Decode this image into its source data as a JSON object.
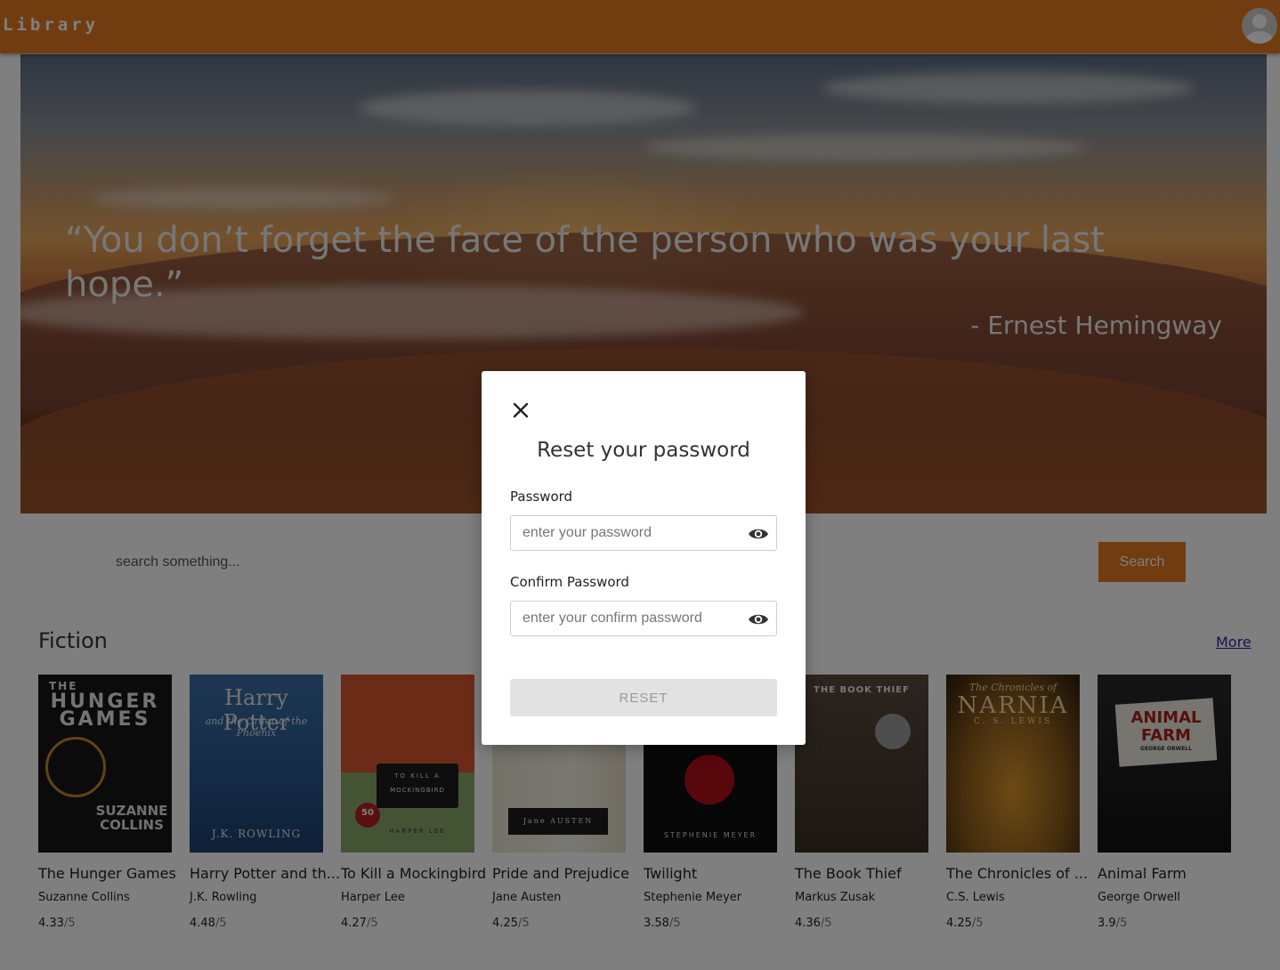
{
  "navbar": {
    "brand": "Library",
    "avatar_icon": "user-avatar-icon"
  },
  "hero": {
    "quote": "“You don’t forget the face of the person who was your last hope.”",
    "author": "- Ernest Hemingway"
  },
  "search": {
    "placeholder": "search something...",
    "button_label": "Search"
  },
  "section": {
    "title": "Fiction",
    "more_label": "More",
    "books": [
      {
        "title": "The Hunger Games",
        "author": "Suzanne Collins",
        "rating": "4.33",
        "max": "/5",
        "cover": {
          "line1": "THE",
          "line2": "HUNGER",
          "line3": "GAMES",
          "line4": "SUZANNE",
          "line5": "COLLINS"
        }
      },
      {
        "title": "Harry Potter and th...",
        "author": "J.K. Rowling",
        "rating": "4.48",
        "max": "/5",
        "cover": {
          "line1": "Harry Potter",
          "line2": "and the Order of the Phoenix",
          "line3": "J.K. ROWLING"
        }
      },
      {
        "title": "To Kill a Mockingbird",
        "author": "Harper Lee",
        "rating": "4.27",
        "max": "/5",
        "cover": {
          "line1": "TO KILL A",
          "line2": "MOCKINGBIRD",
          "line3": "HARPER LEE",
          "line4": "50"
        }
      },
      {
        "title": "Pride and Prejudice",
        "author": "Jane Austen",
        "rating": "4.25",
        "max": "/5",
        "cover": {
          "line1": "Jane AUSTEN"
        }
      },
      {
        "title": "Twilight",
        "author": "Stephenie Meyer",
        "rating": "3.58",
        "max": "/5",
        "cover": {
          "line1": "STEPHENIE MEYER"
        }
      },
      {
        "title": "The Book Thief",
        "author": "Markus Zusak",
        "rating": "4.36",
        "max": "/5",
        "cover": {
          "line1": "THE BOOK THIEF"
        }
      },
      {
        "title": "The Chronicles of ...",
        "author": "C.S. Lewis",
        "rating": "4.25",
        "max": "/5",
        "cover": {
          "line1": "The Chronicles of",
          "line2": "NARNIA",
          "line3": "C. S. LEWIS"
        }
      },
      {
        "title": "Animal Farm",
        "author": "George Orwell",
        "rating": "3.9",
        "max": "/5",
        "cover": {
          "line1": "ANIMAL",
          "line2": "FARM",
          "line3": "GEORGE ORWELL"
        }
      }
    ]
  },
  "modal": {
    "title": "Reset your password",
    "password_label": "Password",
    "password_placeholder": "enter your password",
    "confirm_label": "Confirm Password",
    "confirm_placeholder": "enter your confirm password",
    "reset_label": "RESET",
    "close_icon": "close-icon",
    "eye_icon": "eye-icon"
  },
  "colors": {
    "accent": "#e27b20",
    "link": "#3a1e90",
    "overlay": "rgba(0,0,0,0.5)",
    "disabled_button": "#e2e2e2"
  }
}
